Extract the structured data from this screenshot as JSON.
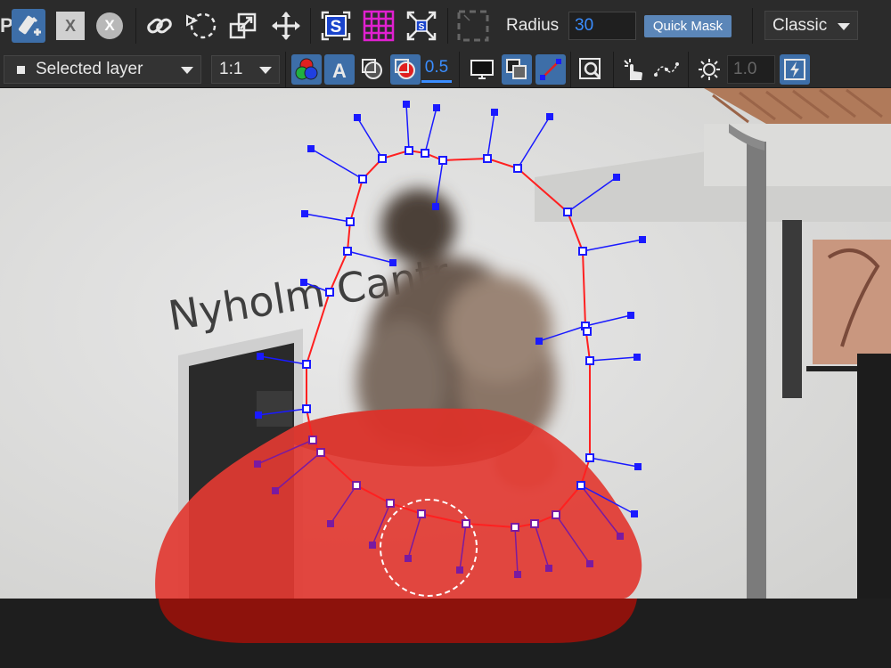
{
  "toolbar": {
    "radius_label": "Radius",
    "radius_value": "30",
    "quick_mask_label": "Quick Mask",
    "mode_value": "Classic",
    "close_x_label": "X",
    "clear_x_label": "X"
  },
  "toolbar2": {
    "layer_select_value": "Selected layer",
    "zoom_value": "1:1",
    "opacity_value": "0.5",
    "threshold_value": "1.0"
  },
  "canvas": {
    "sign_text": "Nyholm Cantr"
  },
  "colors": {
    "accent_active": "#3d6ea8",
    "accent_value": "#3a8dff",
    "magenta": "#e020d0",
    "path_red": "#ff2020",
    "handle_blue": "#1a1aff",
    "handle_purple": "#7a1aa0",
    "mask_red": "#e02020"
  },
  "icons": [
    "selection-brush-icon",
    "close-x-icon",
    "clear-x-icon",
    "link-icon",
    "lasso-select-icon",
    "transform-icon",
    "move-icon",
    "smart-select-icon",
    "grid-icon",
    "fit-screen-icon",
    "marquee-icon",
    "color-channels-icon",
    "text-a-icon",
    "overlay-icon",
    "mask-overlay-icon",
    "display-icon",
    "layers-icon",
    "line-tool-icon",
    "zoom-icon",
    "hand-pointer-icon",
    "curve-icon",
    "brightness-icon",
    "lightning-icon"
  ]
}
